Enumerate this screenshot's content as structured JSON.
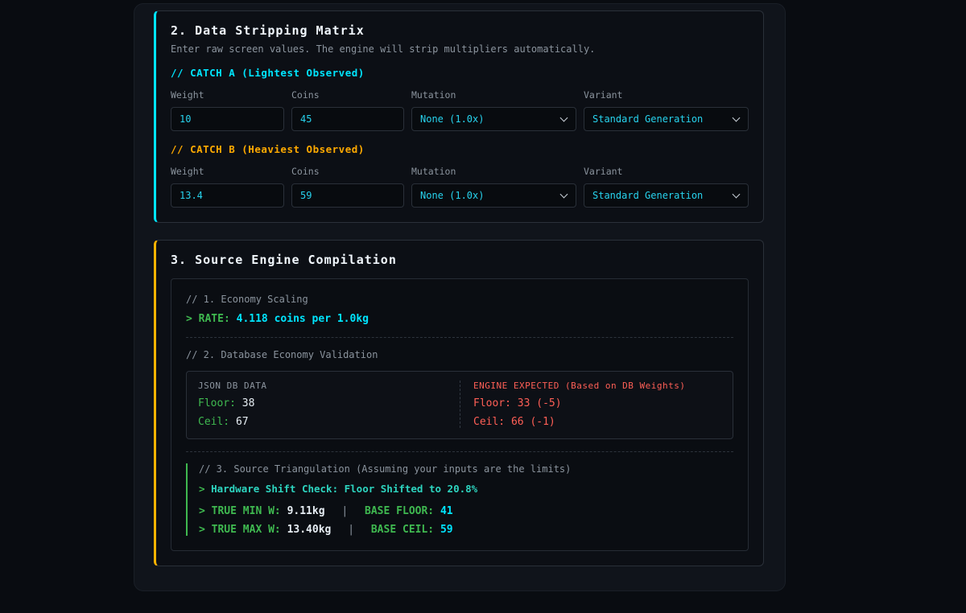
{
  "colors": {
    "accent_cyan": "#00e5ff",
    "accent_amber": "#ffb300",
    "accent_green": "#3fb950",
    "accent_red": "#ff5f56",
    "accent_teal": "#2dd4bf"
  },
  "stripping": {
    "title": "2. Data Stripping Matrix",
    "subtitle": "Enter raw screen values. The engine will strip multipliers automatically.",
    "catch_a": {
      "heading": "// CATCH A (Lightest Observed)",
      "weight_label": "Weight",
      "coins_label": "Coins",
      "mutation_label": "Mutation",
      "variant_label": "Variant",
      "weight_value": "10",
      "coins_value": "45",
      "mutation_value": "None (1.0x)",
      "variant_value": "Standard Generation"
    },
    "catch_b": {
      "heading": "// CATCH B (Heaviest Observed)",
      "weight_label": "Weight",
      "coins_label": "Coins",
      "mutation_label": "Mutation",
      "variant_label": "Variant",
      "weight_value": "13.4",
      "coins_value": "59",
      "mutation_value": "None (1.0x)",
      "variant_value": "Standard Generation"
    }
  },
  "compilation": {
    "title": "3. Source Engine Compilation",
    "economy": {
      "heading": "// 1. Economy Scaling",
      "prompt": ">",
      "rate_label": "RATE:",
      "rate_value": "4.118 coins per 1.0kg"
    },
    "validation": {
      "heading": "// 2. Database Economy Validation",
      "db_header": "JSON DB DATA",
      "db_floor_label": "Floor:",
      "db_floor_value": "38",
      "db_ceil_label": "Ceil:",
      "db_ceil_value": "67",
      "engine_header": "ENGINE EXPECTED (Based on DB Weights)",
      "engine_floor_label": "Floor:",
      "engine_floor_value": "33 (-5)",
      "engine_ceil_label": "Ceil:",
      "engine_ceil_value": "66 (-1)"
    },
    "triangulation": {
      "heading": "// 3. Source Triangulation (Assuming your inputs are the limits)",
      "prompt": ">",
      "shift_text": "Hardware Shift Check: Floor Shifted to 20.8%",
      "min_label": "TRUE MIN W:",
      "min_value": "9.11kg",
      "divider": "|",
      "base_floor_label": "BASE FLOOR:",
      "base_floor_value": "41",
      "max_label": "TRUE MAX W:",
      "max_value": "13.40kg",
      "base_ceil_label": "BASE CEIL:",
      "base_ceil_value": "59"
    }
  }
}
